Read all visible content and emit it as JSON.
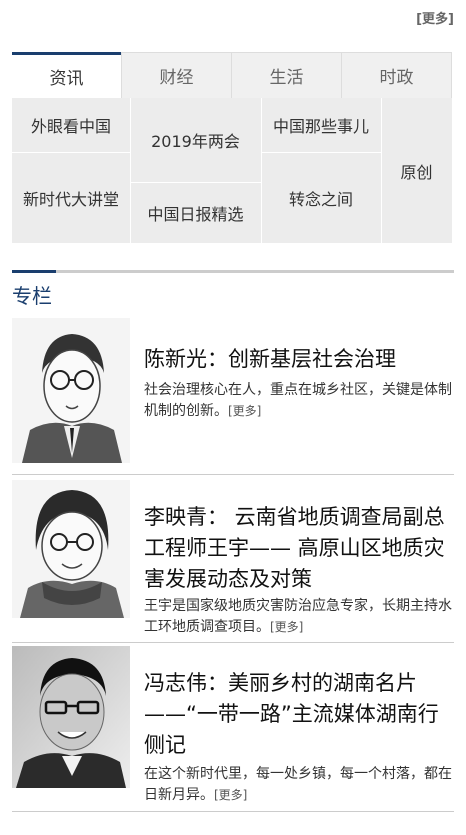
{
  "more_top": "[更多]",
  "tabs": [
    "资讯",
    "财经",
    "生活",
    "时政"
  ],
  "grid": {
    "waiyan": "外眼看中国",
    "lianghui": "2019年两会",
    "naxie": "中国那些事儿",
    "yuanchuang": "原创",
    "xinshidai": "新时代大讲堂",
    "jingxuan": "中国日报精选",
    "zhuannian": "转念之间"
  },
  "column_title": "专栏",
  "articles": [
    {
      "headline": "陈新光：创新基层社会治理",
      "summary": "社会治理核心在人，重点在城乡社区，关键是体制机制的创新。",
      "more": "[更多]",
      "portrait": "portrait-sketch-man-glasses"
    },
    {
      "headline": "李映青： 云南省地质调查局副总工程师王宇—— 高原山区地质灾害发展动态及对策",
      "summary": "王宇是国家级地质灾害防治应急专家，长期主持水工环地质调查项目。",
      "more": "[更多]",
      "portrait": "portrait-sketch-woman"
    },
    {
      "headline": "冯志伟：美丽乡村的湖南名片 ——“一带一路”主流媒体湖南行侧记",
      "summary": "在这个新时代里，每一处乡镇，每一个村落，都在日新月异。",
      "more": "[更多]",
      "portrait": "portrait-bw-photo-man"
    }
  ]
}
